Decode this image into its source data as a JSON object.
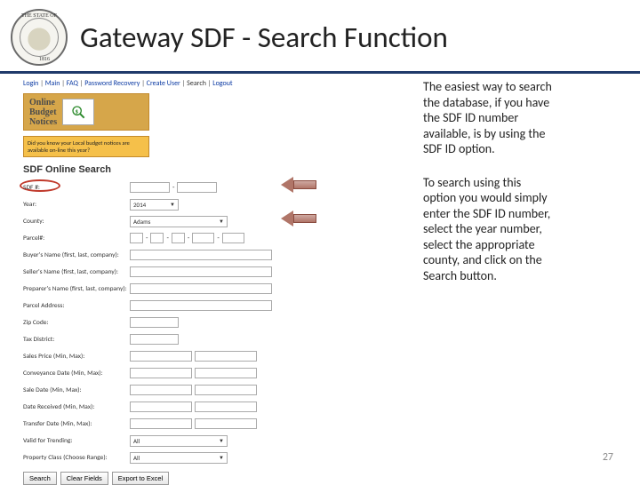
{
  "seal_bottom": "1816",
  "seal_top": "THE STATE OF",
  "title": "Gateway SDF - Search Function",
  "nav": {
    "login": "Login",
    "main": "Main",
    "faq": "FAQ",
    "pw": "Password Recovery",
    "create": "Create User",
    "search": "Search",
    "logout": "Logout"
  },
  "banner_l1": "Online",
  "banner_l2": "Budget",
  "banner_l3": "Notices",
  "yellowbar_text": "Did you know your Local budget notices are available on-line this year?",
  "search_title": "SDF Online Search",
  "rows": {
    "sdfid": {
      "label": "SDF #:"
    },
    "year": {
      "label": "Year:",
      "value": "2014"
    },
    "county": {
      "label": "County:",
      "value": "Adams"
    },
    "parcel": {
      "label": "Parcel#:"
    },
    "buyer": {
      "label": "Buyer's Name (first, last, company):"
    },
    "seller": {
      "label": "Seller's Name (first, last, company):"
    },
    "preparer": {
      "label": "Preparer's Name (first, last, company):"
    },
    "paddr": {
      "label": "Parcel Address:"
    },
    "zip": {
      "label": "Zip Code:"
    },
    "taxdist": {
      "label": "Tax District:"
    },
    "sprice": {
      "label": "Sales Price (Min, Max):"
    },
    "convdate": {
      "label": "Conveyance Date (Min, Max):"
    },
    "sdate": {
      "label": "Sale Date (Min, Max):"
    },
    "drecv": {
      "label": "Date Received (Min, Max):"
    },
    "tdate": {
      "label": "Transfer Date (Min, Max):"
    },
    "trend": {
      "label": "Valid for Trending:",
      "value": "All"
    },
    "pclass": {
      "label": "Property Class (Choose Range):",
      "value": "All"
    }
  },
  "buttons": {
    "search": "Search",
    "clear": "Clear Fields",
    "export": "Export to Excel"
  },
  "para1": "The easiest way to search the database, if you have the SDF ID number available, is by using the SDF ID option.",
  "para2": "To search using this option you would simply enter the SDF ID number, select the year number, select the appropriate county, and click on the Search button.",
  "page_number": "27"
}
